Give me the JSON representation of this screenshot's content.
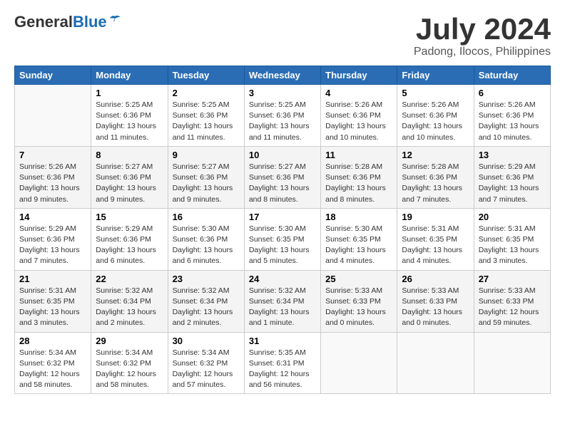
{
  "header": {
    "logo_line1": "General",
    "logo_line2": "Blue",
    "title": "July 2024",
    "location": "Padong, Ilocos, Philippines"
  },
  "columns": [
    "Sunday",
    "Monday",
    "Tuesday",
    "Wednesday",
    "Thursday",
    "Friday",
    "Saturday"
  ],
  "weeks": [
    [
      {
        "day": "",
        "detail": ""
      },
      {
        "day": "1",
        "detail": "Sunrise: 5:25 AM\nSunset: 6:36 PM\nDaylight: 13 hours\nand 11 minutes."
      },
      {
        "day": "2",
        "detail": "Sunrise: 5:25 AM\nSunset: 6:36 PM\nDaylight: 13 hours\nand 11 minutes."
      },
      {
        "day": "3",
        "detail": "Sunrise: 5:25 AM\nSunset: 6:36 PM\nDaylight: 13 hours\nand 11 minutes."
      },
      {
        "day": "4",
        "detail": "Sunrise: 5:26 AM\nSunset: 6:36 PM\nDaylight: 13 hours\nand 10 minutes."
      },
      {
        "day": "5",
        "detail": "Sunrise: 5:26 AM\nSunset: 6:36 PM\nDaylight: 13 hours\nand 10 minutes."
      },
      {
        "day": "6",
        "detail": "Sunrise: 5:26 AM\nSunset: 6:36 PM\nDaylight: 13 hours\nand 10 minutes."
      }
    ],
    [
      {
        "day": "7",
        "detail": "Sunrise: 5:26 AM\nSunset: 6:36 PM\nDaylight: 13 hours\nand 9 minutes."
      },
      {
        "day": "8",
        "detail": "Sunrise: 5:27 AM\nSunset: 6:36 PM\nDaylight: 13 hours\nand 9 minutes."
      },
      {
        "day": "9",
        "detail": "Sunrise: 5:27 AM\nSunset: 6:36 PM\nDaylight: 13 hours\nand 9 minutes."
      },
      {
        "day": "10",
        "detail": "Sunrise: 5:27 AM\nSunset: 6:36 PM\nDaylight: 13 hours\nand 8 minutes."
      },
      {
        "day": "11",
        "detail": "Sunrise: 5:28 AM\nSunset: 6:36 PM\nDaylight: 13 hours\nand 8 minutes."
      },
      {
        "day": "12",
        "detail": "Sunrise: 5:28 AM\nSunset: 6:36 PM\nDaylight: 13 hours\nand 7 minutes."
      },
      {
        "day": "13",
        "detail": "Sunrise: 5:29 AM\nSunset: 6:36 PM\nDaylight: 13 hours\nand 7 minutes."
      }
    ],
    [
      {
        "day": "14",
        "detail": "Sunrise: 5:29 AM\nSunset: 6:36 PM\nDaylight: 13 hours\nand 7 minutes."
      },
      {
        "day": "15",
        "detail": "Sunrise: 5:29 AM\nSunset: 6:36 PM\nDaylight: 13 hours\nand 6 minutes."
      },
      {
        "day": "16",
        "detail": "Sunrise: 5:30 AM\nSunset: 6:36 PM\nDaylight: 13 hours\nand 6 minutes."
      },
      {
        "day": "17",
        "detail": "Sunrise: 5:30 AM\nSunset: 6:35 PM\nDaylight: 13 hours\nand 5 minutes."
      },
      {
        "day": "18",
        "detail": "Sunrise: 5:30 AM\nSunset: 6:35 PM\nDaylight: 13 hours\nand 4 minutes."
      },
      {
        "day": "19",
        "detail": "Sunrise: 5:31 AM\nSunset: 6:35 PM\nDaylight: 13 hours\nand 4 minutes."
      },
      {
        "day": "20",
        "detail": "Sunrise: 5:31 AM\nSunset: 6:35 PM\nDaylight: 13 hours\nand 3 minutes."
      }
    ],
    [
      {
        "day": "21",
        "detail": "Sunrise: 5:31 AM\nSunset: 6:35 PM\nDaylight: 13 hours\nand 3 minutes."
      },
      {
        "day": "22",
        "detail": "Sunrise: 5:32 AM\nSunset: 6:34 PM\nDaylight: 13 hours\nand 2 minutes."
      },
      {
        "day": "23",
        "detail": "Sunrise: 5:32 AM\nSunset: 6:34 PM\nDaylight: 13 hours\nand 2 minutes."
      },
      {
        "day": "24",
        "detail": "Sunrise: 5:32 AM\nSunset: 6:34 PM\nDaylight: 13 hours\nand 1 minute."
      },
      {
        "day": "25",
        "detail": "Sunrise: 5:33 AM\nSunset: 6:33 PM\nDaylight: 13 hours\nand 0 minutes."
      },
      {
        "day": "26",
        "detail": "Sunrise: 5:33 AM\nSunset: 6:33 PM\nDaylight: 13 hours\nand 0 minutes."
      },
      {
        "day": "27",
        "detail": "Sunrise: 5:33 AM\nSunset: 6:33 PM\nDaylight: 12 hours\nand 59 minutes."
      }
    ],
    [
      {
        "day": "28",
        "detail": "Sunrise: 5:34 AM\nSunset: 6:32 PM\nDaylight: 12 hours\nand 58 minutes."
      },
      {
        "day": "29",
        "detail": "Sunrise: 5:34 AM\nSunset: 6:32 PM\nDaylight: 12 hours\nand 58 minutes."
      },
      {
        "day": "30",
        "detail": "Sunrise: 5:34 AM\nSunset: 6:32 PM\nDaylight: 12 hours\nand 57 minutes."
      },
      {
        "day": "31",
        "detail": "Sunrise: 5:35 AM\nSunset: 6:31 PM\nDaylight: 12 hours\nand 56 minutes."
      },
      {
        "day": "",
        "detail": ""
      },
      {
        "day": "",
        "detail": ""
      },
      {
        "day": "",
        "detail": ""
      }
    ]
  ]
}
